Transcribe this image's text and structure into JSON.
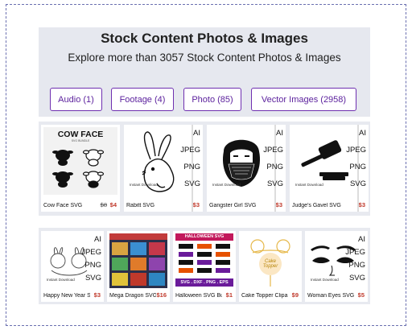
{
  "header": {
    "title": "Stock Content Photos & Images",
    "subtitle": "Explore more than 3057 Stock Content Photos & Images"
  },
  "filters": [
    {
      "label": "Audio (1)"
    },
    {
      "label": "Footage (4)"
    },
    {
      "label": "Photo (85)"
    },
    {
      "label": "Vector Images (2958)"
    }
  ],
  "formats_full": [
    "AI",
    "JPEG",
    "PNG",
    "SVG"
  ],
  "row1": [
    {
      "name": "Cow Face SVG",
      "old_price": "$8",
      "price": "$4",
      "thumb_title": "COW FACE",
      "thumb_sub": "SVG BUNDLE",
      "icon": "cow-face-icon"
    },
    {
      "name": "Rabitt SVG",
      "price": "$3",
      "instant": "Instant Download",
      "icon": "rabbit-icon"
    },
    {
      "name": "Gangster Girl SVG",
      "price": "$3",
      "instant": "Instant Download",
      "icon": "gangster-girl-icon"
    },
    {
      "name": "Judge's Gavel SVG",
      "price": "$3",
      "instant": "Instant Download",
      "icon": "gavel-icon"
    }
  ],
  "row2": [
    {
      "name": "Happy New Year SVG",
      "price": "$3",
      "instant": "Instant Download",
      "icon": "bunnies-icon"
    },
    {
      "name": "Mega Dragon SVG",
      "price": "$16",
      "icon": "dragon-bundle-icon"
    },
    {
      "name": "Halloween SVG Bu...",
      "price": "$1",
      "banner": "HALLOWEEN SVG BUNDLE",
      "footer": "SVG . DXF . PNG . EPS",
      "icon": "halloween-bundle-icon"
    },
    {
      "name": "Cake Topper Clipa...",
      "price": "$9",
      "topper": "Cake Topper",
      "icon": "cake-topper-icon"
    },
    {
      "name": "Woman Eyes SVG",
      "price": "$5",
      "instant": "Instant Download",
      "icon": "woman-eyes-icon"
    }
  ],
  "colors": {
    "accent": "#6f2fb0",
    "price": "#c0392b",
    "panel": "#e6e8ef"
  }
}
